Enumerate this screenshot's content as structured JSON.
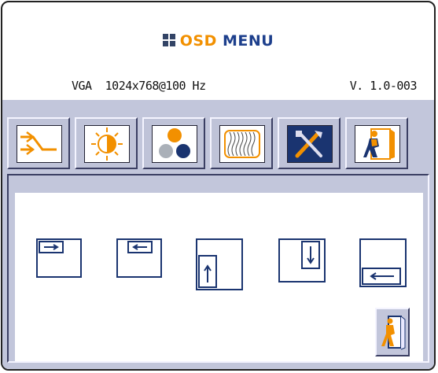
{
  "title": {
    "prefix_icon": "grid-icon",
    "osd": "OSD",
    "menu": "MENU"
  },
  "info": {
    "mode": "VGA  1024x768@100 Hz",
    "version": "V. 1.0-003"
  },
  "colors": {
    "accent_orange": "#f29000",
    "accent_blue": "#1d3f8c",
    "panel": "#c2c6db",
    "active_tab": "#1a3470"
  },
  "tabs": [
    {
      "icon": "input-select-icon",
      "active": false
    },
    {
      "icon": "brightness-contrast-icon",
      "active": false
    },
    {
      "icon": "color-balls-icon",
      "active": false
    },
    {
      "icon": "phase-wave-icon",
      "active": false
    },
    {
      "icon": "tools-icon",
      "active": true
    },
    {
      "icon": "exit-door-icon",
      "active": false
    }
  ],
  "submenu": {
    "items": [
      {
        "icon": "h-position-right-icon"
      },
      {
        "icon": "h-position-left-icon"
      },
      {
        "icon": "v-position-up-icon"
      },
      {
        "icon": "v-position-down-icon"
      },
      {
        "icon": "osd-position-icon"
      }
    ],
    "exit_icon": "exit-door-icon"
  }
}
